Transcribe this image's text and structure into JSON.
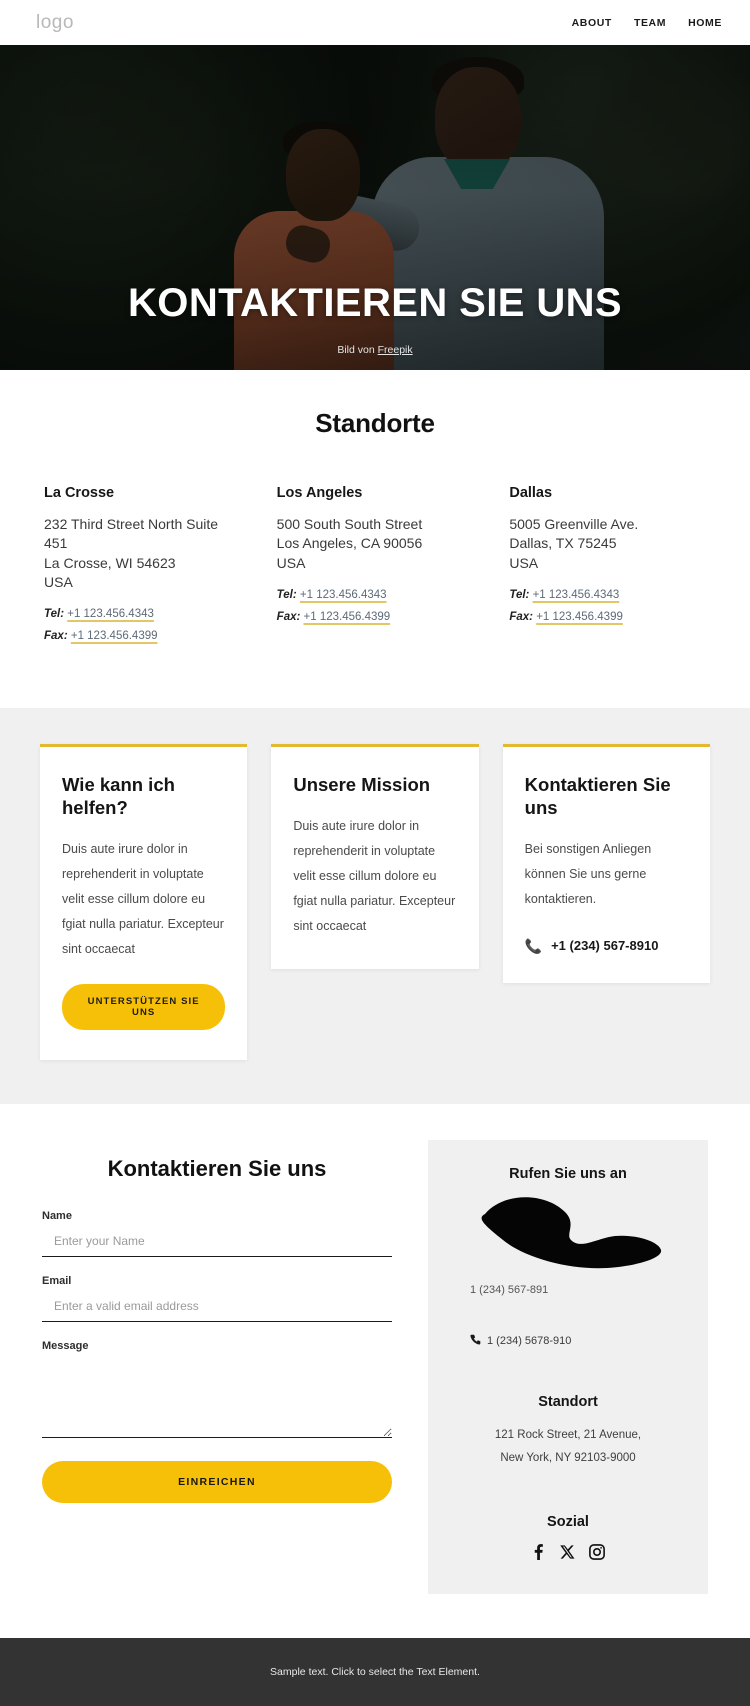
{
  "header": {
    "logo": "logo",
    "nav": [
      {
        "label": "ABOUT"
      },
      {
        "label": "TEAM"
      },
      {
        "label": "HOME"
      }
    ]
  },
  "hero": {
    "title": "KONTAKTIEREN SIE UNS",
    "caption_prefix": "Bild von ",
    "caption_link": "Freepik"
  },
  "locations": {
    "title": "Standorte",
    "tel_label": "Tel:",
    "fax_label": "Fax:",
    "items": [
      {
        "name": "La Crosse",
        "address": "232 Third Street North Suite 451\nLa Crosse, WI 54623\nUSA",
        "tel": "+1 123.456.4343",
        "fax": "+1 123.456.4399"
      },
      {
        "name": "Los Angeles",
        "address": "500 South South Street\nLos Angeles, CA 90056\nUSA",
        "tel": "+1 123.456.4343",
        "fax": "+1 123.456.4399"
      },
      {
        "name": "Dallas",
        "address": "5005 Greenville Ave.\nDallas, TX 75245\nUSA",
        "tel": "+1 123.456.4343",
        "fax": "+1 123.456.4399"
      }
    ]
  },
  "cards": [
    {
      "title": "Wie kann ich helfen?",
      "body": "Duis aute irure dolor in reprehenderit in voluptate velit esse cillum dolore eu fgiat nulla pariatur. Excepteur sint occaecat",
      "cta": "UNTERSTÜTZEN SIE UNS"
    },
    {
      "title": "Unsere Mission",
      "body": "Duis aute irure dolor in reprehenderit in voluptate velit esse cillum dolore eu fgiat nulla pariatur. Excepteur sint occaecat"
    },
    {
      "title": "Kontaktieren Sie uns",
      "body": "Bei sonstigen Anliegen können Sie uns gerne kontaktieren.",
      "phone": "+1 (234) 567-8910"
    }
  ],
  "contact": {
    "form_title": "Kontaktieren Sie uns",
    "name_label": "Name",
    "name_placeholder": "Enter your Name",
    "email_label": "Email",
    "email_placeholder": "Enter a valid email address",
    "message_label": "Message",
    "message_placeholder": "",
    "submit_label": "EINREICHEN"
  },
  "aside": {
    "call_title": "Rufen Sie uns an",
    "phone_primary": "1 (234) 567-891",
    "phone_secondary": "1 (234) 5678-910",
    "location_title": "Standort",
    "address": "121 Rock Street, 21 Avenue,\nNew York, NY 92103-9000",
    "social_title": "Sozial",
    "social": [
      {
        "name": "facebook-icon"
      },
      {
        "name": "x-twitter-icon"
      },
      {
        "name": "instagram-icon"
      }
    ]
  },
  "footer": {
    "text": "Sample text. Click to select the Text Element."
  },
  "colors": {
    "accent_yellow": "#f7c008",
    "card_border": "#e3b932",
    "underline_yellow": "#e3c766",
    "footer_bg": "#333333",
    "section_gray": "#f0f0f0"
  }
}
